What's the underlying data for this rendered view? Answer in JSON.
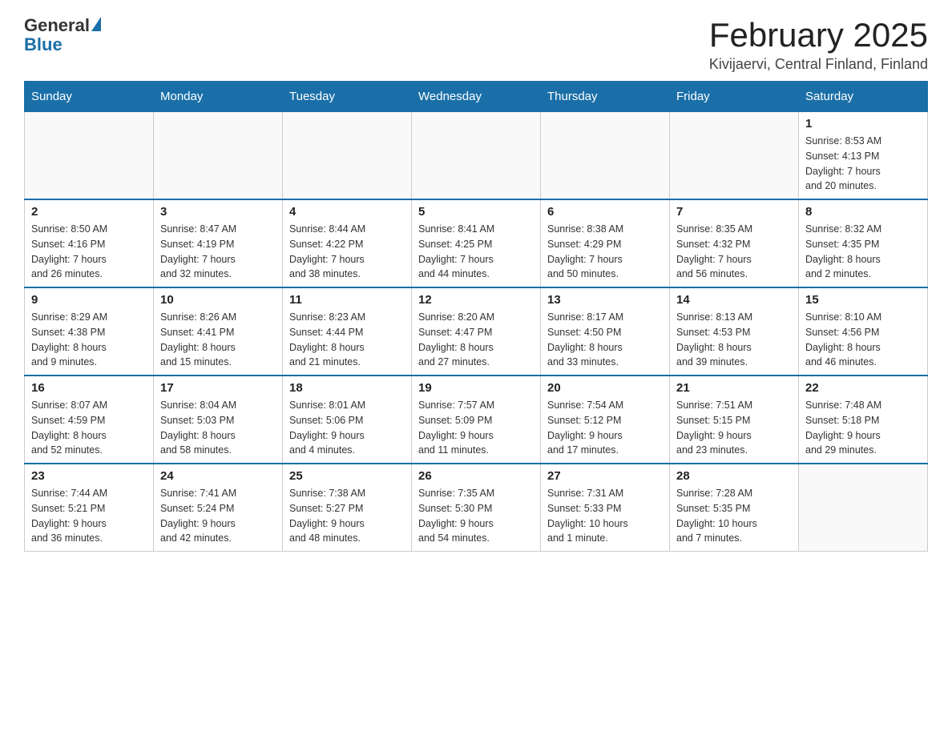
{
  "header": {
    "logo_general": "General",
    "logo_blue": "Blue",
    "month_title": "February 2025",
    "location": "Kivijaervi, Central Finland, Finland"
  },
  "weekdays": [
    "Sunday",
    "Monday",
    "Tuesday",
    "Wednesday",
    "Thursday",
    "Friday",
    "Saturday"
  ],
  "weeks": [
    [
      {
        "day": "",
        "info": ""
      },
      {
        "day": "",
        "info": ""
      },
      {
        "day": "",
        "info": ""
      },
      {
        "day": "",
        "info": ""
      },
      {
        "day": "",
        "info": ""
      },
      {
        "day": "",
        "info": ""
      },
      {
        "day": "1",
        "info": "Sunrise: 8:53 AM\nSunset: 4:13 PM\nDaylight: 7 hours\nand 20 minutes."
      }
    ],
    [
      {
        "day": "2",
        "info": "Sunrise: 8:50 AM\nSunset: 4:16 PM\nDaylight: 7 hours\nand 26 minutes."
      },
      {
        "day": "3",
        "info": "Sunrise: 8:47 AM\nSunset: 4:19 PM\nDaylight: 7 hours\nand 32 minutes."
      },
      {
        "day": "4",
        "info": "Sunrise: 8:44 AM\nSunset: 4:22 PM\nDaylight: 7 hours\nand 38 minutes."
      },
      {
        "day": "5",
        "info": "Sunrise: 8:41 AM\nSunset: 4:25 PM\nDaylight: 7 hours\nand 44 minutes."
      },
      {
        "day": "6",
        "info": "Sunrise: 8:38 AM\nSunset: 4:29 PM\nDaylight: 7 hours\nand 50 minutes."
      },
      {
        "day": "7",
        "info": "Sunrise: 8:35 AM\nSunset: 4:32 PM\nDaylight: 7 hours\nand 56 minutes."
      },
      {
        "day": "8",
        "info": "Sunrise: 8:32 AM\nSunset: 4:35 PM\nDaylight: 8 hours\nand 2 minutes."
      }
    ],
    [
      {
        "day": "9",
        "info": "Sunrise: 8:29 AM\nSunset: 4:38 PM\nDaylight: 8 hours\nand 9 minutes."
      },
      {
        "day": "10",
        "info": "Sunrise: 8:26 AM\nSunset: 4:41 PM\nDaylight: 8 hours\nand 15 minutes."
      },
      {
        "day": "11",
        "info": "Sunrise: 8:23 AM\nSunset: 4:44 PM\nDaylight: 8 hours\nand 21 minutes."
      },
      {
        "day": "12",
        "info": "Sunrise: 8:20 AM\nSunset: 4:47 PM\nDaylight: 8 hours\nand 27 minutes."
      },
      {
        "day": "13",
        "info": "Sunrise: 8:17 AM\nSunset: 4:50 PM\nDaylight: 8 hours\nand 33 minutes."
      },
      {
        "day": "14",
        "info": "Sunrise: 8:13 AM\nSunset: 4:53 PM\nDaylight: 8 hours\nand 39 minutes."
      },
      {
        "day": "15",
        "info": "Sunrise: 8:10 AM\nSunset: 4:56 PM\nDaylight: 8 hours\nand 46 minutes."
      }
    ],
    [
      {
        "day": "16",
        "info": "Sunrise: 8:07 AM\nSunset: 4:59 PM\nDaylight: 8 hours\nand 52 minutes."
      },
      {
        "day": "17",
        "info": "Sunrise: 8:04 AM\nSunset: 5:03 PM\nDaylight: 8 hours\nand 58 minutes."
      },
      {
        "day": "18",
        "info": "Sunrise: 8:01 AM\nSunset: 5:06 PM\nDaylight: 9 hours\nand 4 minutes."
      },
      {
        "day": "19",
        "info": "Sunrise: 7:57 AM\nSunset: 5:09 PM\nDaylight: 9 hours\nand 11 minutes."
      },
      {
        "day": "20",
        "info": "Sunrise: 7:54 AM\nSunset: 5:12 PM\nDaylight: 9 hours\nand 17 minutes."
      },
      {
        "day": "21",
        "info": "Sunrise: 7:51 AM\nSunset: 5:15 PM\nDaylight: 9 hours\nand 23 minutes."
      },
      {
        "day": "22",
        "info": "Sunrise: 7:48 AM\nSunset: 5:18 PM\nDaylight: 9 hours\nand 29 minutes."
      }
    ],
    [
      {
        "day": "23",
        "info": "Sunrise: 7:44 AM\nSunset: 5:21 PM\nDaylight: 9 hours\nand 36 minutes."
      },
      {
        "day": "24",
        "info": "Sunrise: 7:41 AM\nSunset: 5:24 PM\nDaylight: 9 hours\nand 42 minutes."
      },
      {
        "day": "25",
        "info": "Sunrise: 7:38 AM\nSunset: 5:27 PM\nDaylight: 9 hours\nand 48 minutes."
      },
      {
        "day": "26",
        "info": "Sunrise: 7:35 AM\nSunset: 5:30 PM\nDaylight: 9 hours\nand 54 minutes."
      },
      {
        "day": "27",
        "info": "Sunrise: 7:31 AM\nSunset: 5:33 PM\nDaylight: 10 hours\nand 1 minute."
      },
      {
        "day": "28",
        "info": "Sunrise: 7:28 AM\nSunset: 5:35 PM\nDaylight: 10 hours\nand 7 minutes."
      },
      {
        "day": "",
        "info": ""
      }
    ]
  ]
}
